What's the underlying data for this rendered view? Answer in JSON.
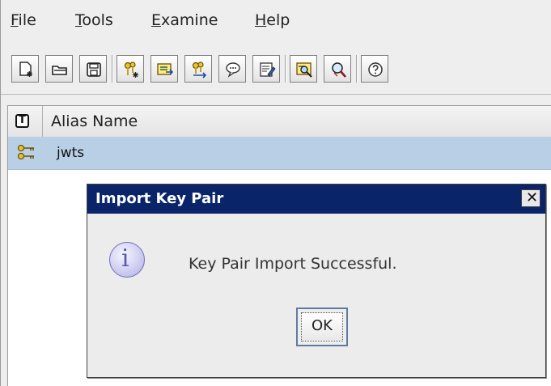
{
  "menu": [
    {
      "label": "File",
      "mnemonic": "F",
      "rest": "ile"
    },
    {
      "label": "Tools",
      "mnemonic": "T",
      "rest": "ools"
    },
    {
      "label": "Examine",
      "mnemonic": "E",
      "rest": "xamine"
    },
    {
      "label": "Help",
      "mnemonic": "H",
      "rest": "elp"
    }
  ],
  "toolbar": {
    "icons": [
      "new-keystore-icon",
      "open-keystore-icon",
      "save-keystore-icon",
      "generate-key-pair-icon",
      "import-certificate-icon",
      "import-key-pair-icon",
      "message-icon",
      "edit-icon",
      "examine-certificate-icon",
      "examine-ssl-icon",
      "help-icon"
    ]
  },
  "table": {
    "header": "Alias Name",
    "rows": [
      {
        "alias": "jwts"
      }
    ]
  },
  "dialog": {
    "title": "Import Key Pair",
    "close": "✕",
    "message": "Key Pair Import Successful.",
    "info_glyph": "i",
    "ok_label": "OK"
  },
  "colors": {
    "selection": "#b8cfe5",
    "titlebar": "#0a246a"
  }
}
